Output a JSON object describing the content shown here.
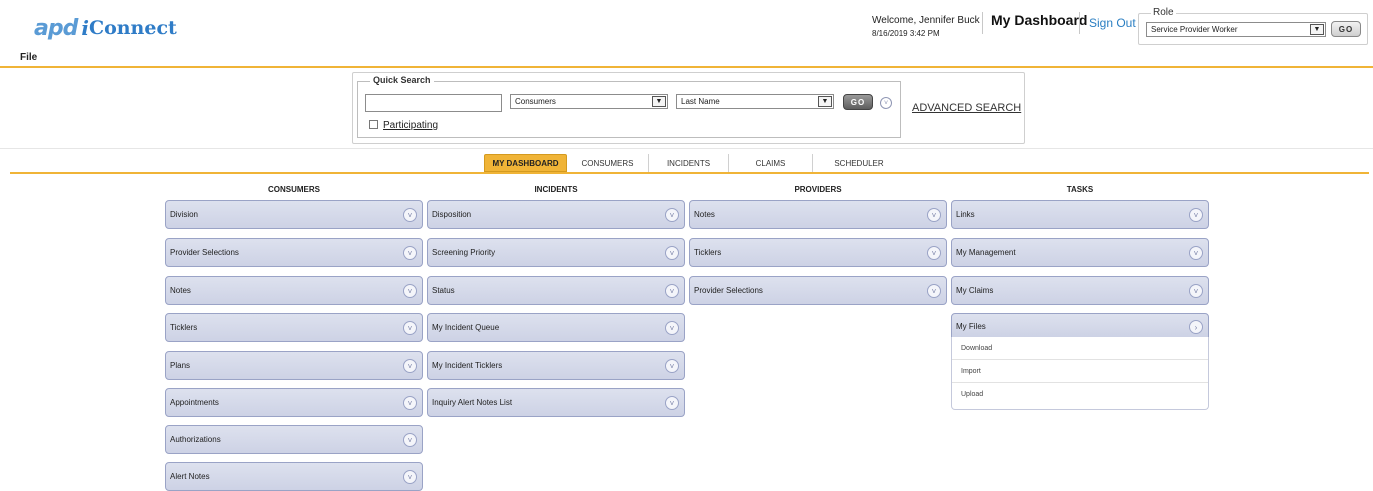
{
  "header": {
    "logo_apd": "apd",
    "logo_i": "i",
    "logo_connect": "Connect",
    "welcome": "Welcome, Jennifer Buck",
    "datetime": "8/16/2019 3:42 PM",
    "dashboard_title": "My Dashboard",
    "sign_out": "Sign Out",
    "role_label": "Role",
    "role_value": "Service Provider Worker",
    "go_label": "GO"
  },
  "menu": {
    "file": "File"
  },
  "quick_search": {
    "legend": "Quick Search",
    "search_value": "",
    "type_value": "Consumers",
    "field_value": "Last Name",
    "go_label": "GO",
    "participating_label": "Participating",
    "advanced_search": "ADVANCED SEARCH"
  },
  "tabs": [
    {
      "label": "MY DASHBOARD",
      "active": true
    },
    {
      "label": "CONSUMERS",
      "active": false
    },
    {
      "label": "INCIDENTS",
      "active": false
    },
    {
      "label": "CLAIMS",
      "active": false
    },
    {
      "label": "SCHEDULER",
      "active": false
    }
  ],
  "columns": [
    {
      "heading": "CONSUMERS",
      "items": [
        "Division",
        "Provider Selections",
        "Notes",
        "Ticklers",
        "Plans",
        "Appointments",
        "Authorizations",
        "Alert Notes"
      ]
    },
    {
      "heading": "INCIDENTS",
      "items": [
        "Disposition",
        "Screening Priority",
        "Status",
        "My Incident Queue",
        "My Incident Ticklers",
        "Inquiry Alert Notes List"
      ]
    },
    {
      "heading": "PROVIDERS",
      "items": [
        "Notes",
        "Ticklers",
        "Provider Selections"
      ]
    },
    {
      "heading": "TASKS",
      "items": [
        "Links",
        "My Management",
        "My Claims",
        "My Files"
      ]
    }
  ],
  "my_files_submenu": [
    "Download",
    "Import",
    "Upload"
  ],
  "colors": {
    "accent": "#f0b437",
    "panel": "#cdd2e5",
    "link": "#2a7ec2"
  }
}
